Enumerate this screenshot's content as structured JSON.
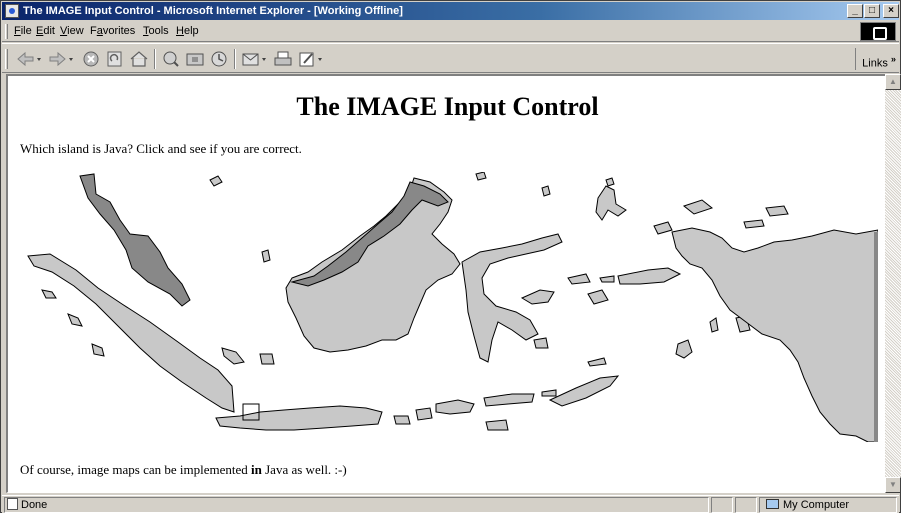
{
  "window": {
    "title": "The IMAGE Input Control - Microsoft Internet Explorer - [Working Offline]",
    "controls": {
      "minimize": "_",
      "maximize": "□",
      "close": "×"
    }
  },
  "menu": {
    "items": [
      {
        "label": "File",
        "key": "F",
        "rest": "ile"
      },
      {
        "label": "Edit",
        "key": "E",
        "rest": "dit"
      },
      {
        "label": "View",
        "key": "V",
        "rest": "iew"
      },
      {
        "label": "Favorites",
        "key": "a",
        "pre": "F",
        "rest": "vorites"
      },
      {
        "label": "Tools",
        "key": "T",
        "rest": "ools"
      },
      {
        "label": "Help",
        "key": "H",
        "rest": "elp"
      }
    ]
  },
  "toolbar": {
    "back_icon": "back-arrow-icon",
    "forward_icon": "forward-arrow-icon",
    "stop_icon": "stop-icon",
    "refresh_icon": "refresh-icon",
    "home_icon": "home-icon",
    "search_icon": "search-icon",
    "favorites_icon": "favorites-icon",
    "history_icon": "history-icon",
    "mail_icon": "mail-icon",
    "print_icon": "print-icon",
    "edit_icon": "edit-icon",
    "links_label": "Links",
    "links_chevron": "»"
  },
  "page": {
    "title": "The IMAGE Input Control",
    "intro": "Which island is Java? Click and see if you are correct.",
    "footer_before": "Of course, image maps can be implemented ",
    "footer_bold": "in",
    "footer_after": " Java as well. :-)",
    "map": {
      "name": "indonesia-map-image-input",
      "land_color": "#c8c8c8",
      "highlight_color": "#888888",
      "outline_color": "#000000"
    }
  },
  "status": {
    "text": "Done",
    "zone": "My Computer"
  }
}
